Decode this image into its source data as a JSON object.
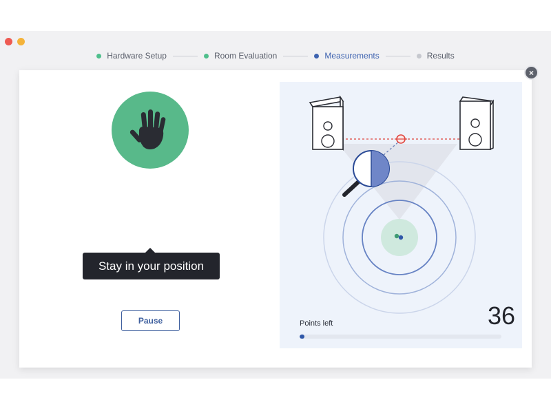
{
  "steps": [
    {
      "label": "Hardware Setup",
      "state": "done",
      "color": "#4fbf8c"
    },
    {
      "label": "Room Evaluation",
      "state": "done",
      "color": "#4fbf8c"
    },
    {
      "label": "Measurements",
      "state": "active",
      "color": "#3e63b0"
    },
    {
      "label": "Results",
      "state": "pending",
      "color": "#c6c8ce"
    }
  ],
  "close_label": "×",
  "instruction": {
    "icon": "hand-stop-icon",
    "message": "Stay in your position"
  },
  "pause_label": "Pause",
  "measurement": {
    "points_label": "Points left",
    "points_left": "36",
    "progress_fraction": 0.025
  },
  "colors": {
    "accent_green": "#58b98a",
    "accent_blue": "#3e63b0",
    "warning_red": "#e0453f"
  }
}
